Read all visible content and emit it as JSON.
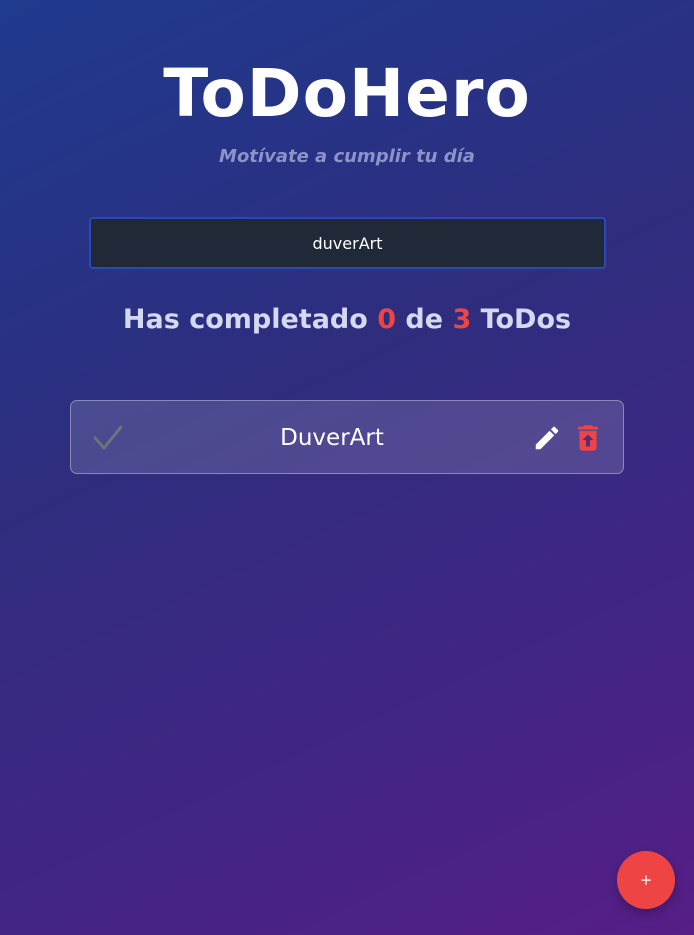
{
  "header": {
    "title": "ToDoHero",
    "subtitle": "Motívate a cumplir tu día"
  },
  "search": {
    "value": "duverArt"
  },
  "progress": {
    "prefix": "Has completado",
    "completed": "0",
    "middle": "de",
    "total": "3",
    "suffix": "ToDos"
  },
  "todos": [
    {
      "text": "DuverArt",
      "completed": false,
      "icons": [
        "check-icon",
        "pencil-icon",
        "trash-icon"
      ]
    }
  ],
  "fab": {
    "label": "+"
  },
  "colors": {
    "accent": "#ef4444",
    "input_bg": "#1f2937",
    "input_border": "#2b48b8",
    "check_inactive": "#6b7280"
  }
}
